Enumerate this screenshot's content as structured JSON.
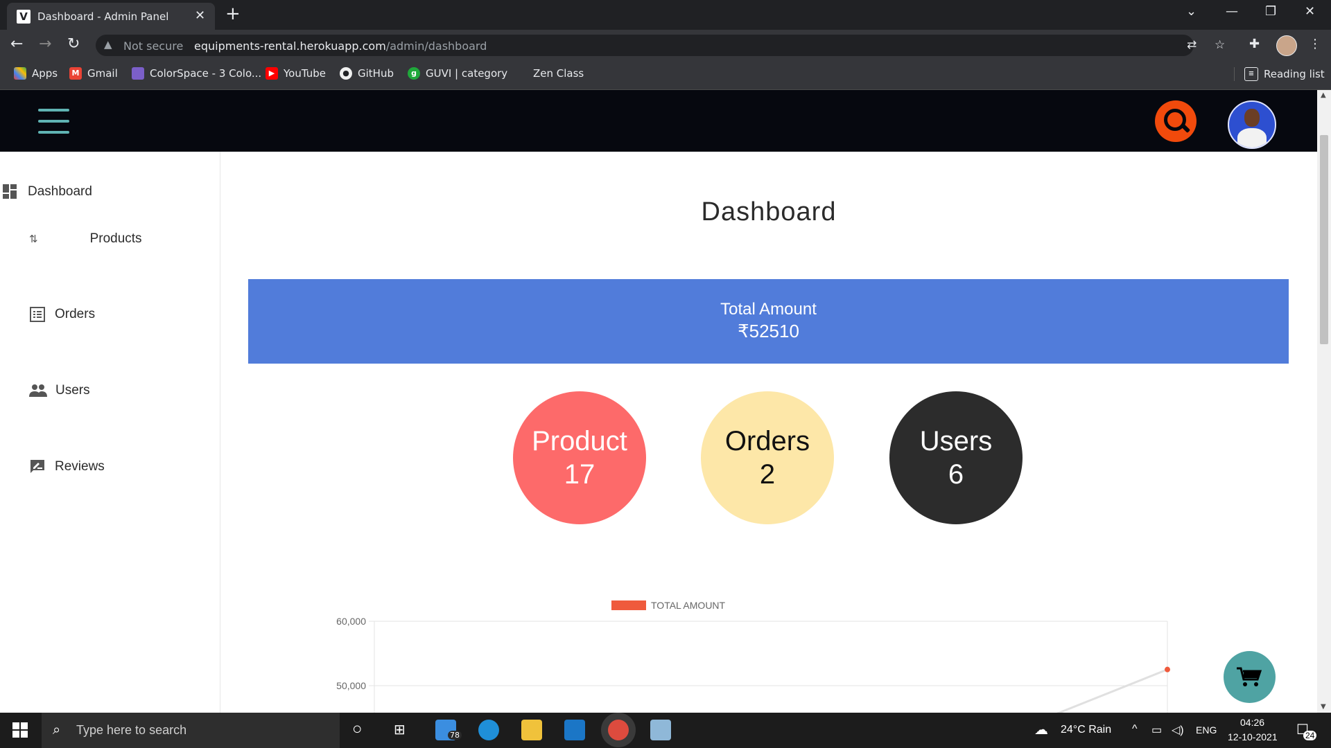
{
  "browser": {
    "tab_title": "Dashboard - Admin Panel",
    "favicon_letter": "V",
    "not_secure": "Not secure",
    "url_host": "equipments-rental.herokuapp.com",
    "url_path": "/admin/dashboard",
    "bookmarks": [
      "Apps",
      "Gmail",
      "ColorSpace - 3 Colo...",
      "YouTube",
      "GitHub",
      "GUVI | category",
      "Zen Class"
    ],
    "reading_list": "Reading list"
  },
  "sidebar": {
    "items": [
      {
        "label": "Dashboard",
        "icon": "dashboard-icon"
      },
      {
        "label": "Products",
        "icon": "swap-vert-icon"
      },
      {
        "label": "Orders",
        "icon": "list-alt-icon"
      },
      {
        "label": "Users",
        "icon": "people-icon"
      },
      {
        "label": "Reviews",
        "icon": "rate-review-icon"
      }
    ]
  },
  "main": {
    "title": "Dashboard",
    "total": {
      "label": "Total Amount",
      "value": "₹52510"
    },
    "stats": {
      "product": {
        "label": "Product",
        "value": "17"
      },
      "orders": {
        "label": "Orders",
        "value": "2"
      },
      "users": {
        "label": "Users",
        "value": "6"
      }
    }
  },
  "colors": {
    "appbar": "#06080f",
    "accent_search": "#f14a0c",
    "total_box": "#517cda",
    "product_circle": "#fd6a6a",
    "orders_circle": "#fde7a8",
    "users_circle": "#2c2c2c",
    "chart_line": "#ef5a3c",
    "fab": "#4fa3a3"
  },
  "chart_data": {
    "type": "line",
    "legend": "TOTAL AMOUNT",
    "y_ticks": [
      "60,000",
      "50,000"
    ],
    "ylim": [
      40000,
      60000
    ],
    "series": [
      {
        "name": "TOTAL AMOUNT",
        "values": [
          52510
        ]
      }
    ]
  },
  "taskbar": {
    "search_placeholder": "Type here to search",
    "mail_badge": "78",
    "weather": "24°C  Rain",
    "lang": "ENG",
    "time": "04:26",
    "date": "12-10-2021",
    "notifications": "24"
  }
}
